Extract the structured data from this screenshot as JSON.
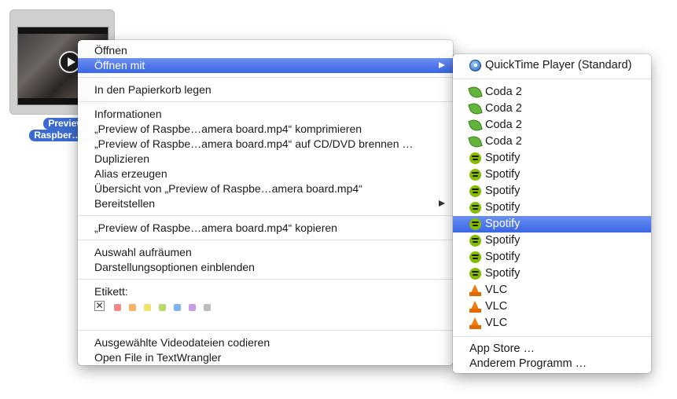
{
  "file": {
    "label_line1": "Preview",
    "label_line2": "Raspber…ar"
  },
  "context_menu": {
    "groups": [
      [
        {
          "label": "Öffnen"
        },
        {
          "label": "Öffnen mit",
          "submenu": true,
          "highlighted": true
        }
      ],
      [
        {
          "label": "In den Papierkorb legen"
        }
      ],
      [
        {
          "label": "Informationen"
        },
        {
          "label": "„Preview of Raspbe…amera board.mp4“ komprimieren"
        },
        {
          "label": "„Preview of Raspbe…amera board.mp4“ auf CD/DVD brennen …"
        },
        {
          "label": "Duplizieren"
        },
        {
          "label": "Alias erzeugen"
        },
        {
          "label": "Übersicht von „Preview of Raspbe…amera board.mp4“"
        },
        {
          "label": "Bereitstellen",
          "submenu": true
        }
      ],
      [
        {
          "label": "„Preview of Raspbe…amera board.mp4“ kopieren"
        }
      ],
      [
        {
          "label": "Auswahl aufräumen"
        },
        {
          "label": "Darstellungsoptionen einblenden"
        }
      ]
    ],
    "label_section": {
      "title": "Etikett:",
      "none_symbol": "✕",
      "colors": [
        "#f08a8a",
        "#f5b561",
        "#f2e26b",
        "#b7dc6a",
        "#7fb4f0",
        "#c99be3",
        "#bdbdbd"
      ]
    },
    "services": [
      {
        "label": "Ausgewählte Videodateien codieren"
      },
      {
        "label": "Open File in TextWrangler"
      }
    ]
  },
  "open_with_submenu": {
    "default_app": {
      "label": "QuickTime Player (Standard)",
      "icon": "quicktime-icon"
    },
    "apps": [
      {
        "label": "Coda 2",
        "icon": "coda-icon"
      },
      {
        "label": "Coda 2",
        "icon": "coda-icon"
      },
      {
        "label": "Coda 2",
        "icon": "coda-icon"
      },
      {
        "label": "Coda 2",
        "icon": "coda-icon"
      },
      {
        "label": "Spotify",
        "icon": "spotify-icon"
      },
      {
        "label": "Spotify",
        "icon": "spotify-icon"
      },
      {
        "label": "Spotify",
        "icon": "spotify-icon"
      },
      {
        "label": "Spotify",
        "icon": "spotify-icon"
      },
      {
        "label": "Spotify",
        "icon": "spotify-icon",
        "highlighted": true
      },
      {
        "label": "Spotify",
        "icon": "spotify-icon"
      },
      {
        "label": "Spotify",
        "icon": "spotify-icon"
      },
      {
        "label": "Spotify",
        "icon": "spotify-icon"
      },
      {
        "label": "VLC",
        "icon": "vlc-icon"
      },
      {
        "label": "VLC",
        "icon": "vlc-icon"
      },
      {
        "label": "VLC",
        "icon": "vlc-icon"
      }
    ],
    "footer": [
      {
        "label": "App Store …"
      },
      {
        "label": "Anderem Programm …"
      }
    ]
  }
}
